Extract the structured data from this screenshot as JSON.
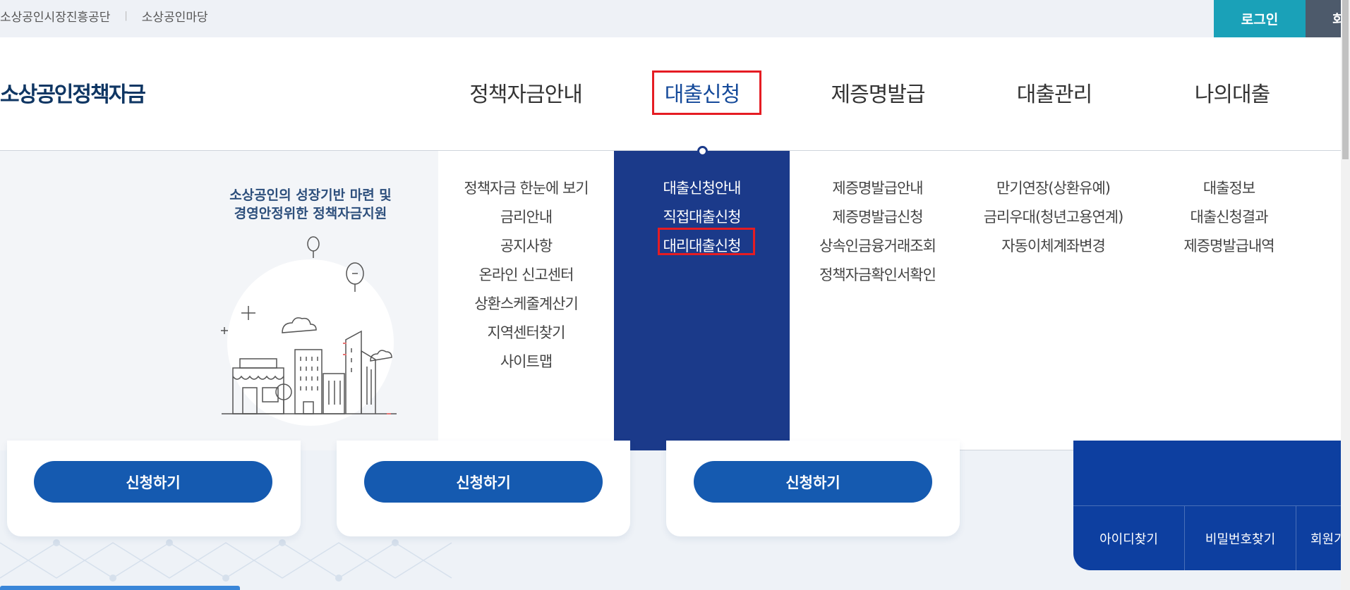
{
  "util_bar": {
    "links": [
      "소상공인시장진흥공단",
      "소상공인마당"
    ],
    "separator": "|",
    "login_label": "로그인",
    "join_label": "회원가입"
  },
  "header": {
    "logo": "소상공인정책자금",
    "gnb": [
      "정책자금안내",
      "대출신청",
      "제증명발급",
      "대출관리",
      "나의대출"
    ],
    "active_index": 1
  },
  "mega_menu": {
    "slogan_line1": "소상공인의 성장기반 마련 및",
    "slogan_line2": "경영안정위한 정책자금지원",
    "columns": [
      [
        "정책자금 한눈에 보기",
        "금리안내",
        "공지사항",
        "온라인 신고센터",
        "상환스케줄계산기",
        "지역센터찾기",
        "사이트맵"
      ],
      [
        "대출신청안내",
        "직접대출신청",
        "대리대출신청"
      ],
      [
        "제증명발급안내",
        "제증명발급신청",
        "상속인금융거래조회",
        "정책자금확인서확인"
      ],
      [
        "만기연장(상환유예)",
        "금리우대(청년고용연계)",
        "자동이체계좌변경"
      ],
      [
        "대출정보",
        "대출신청결과",
        "제증명발급내역"
      ]
    ]
  },
  "cards": {
    "apply_label": "신청하기"
  },
  "login_panel": {
    "links": [
      "아이디찾기",
      "비밀번호찾기",
      "회원가입"
    ]
  },
  "colors": {
    "navy": "#1b3a8a",
    "button_blue": "#155ab0",
    "login_teal": "#1aa1b8",
    "highlight_red": "#e51c23"
  }
}
